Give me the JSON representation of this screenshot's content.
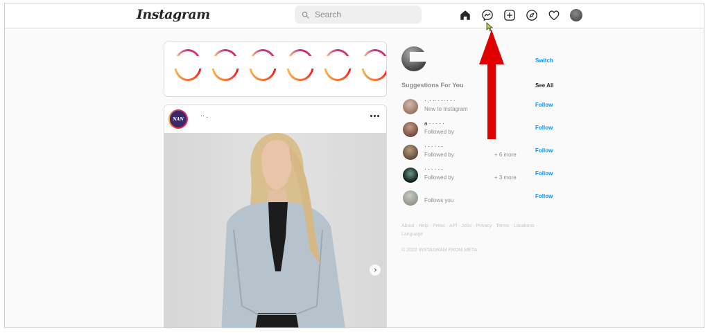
{
  "header": {
    "logo": "Instagram",
    "search_placeholder": "Search"
  },
  "nav_icons": [
    "home-icon",
    "messenger-icon",
    "new-post-icon",
    "explore-icon",
    "activity-heart-icon",
    "profile-avatar"
  ],
  "post": {
    "avatar_text": "NAN",
    "username": "·· .",
    "menu_icon": "more-horizontal-icon"
  },
  "sidebar": {
    "switch_label": "Switch",
    "suggestions_title": "Suggestions For You",
    "see_all": "See All",
    "suggestions": [
      {
        "name": "· .· ·· · ·· · · ·",
        "subtitle": "New to Instagram",
        "more": "",
        "follow": "Follow"
      },
      {
        "name": "a · · · · ·",
        "subtitle": "Followed by",
        "more": "",
        "follow": "Follow"
      },
      {
        "name": "· · · · · ·",
        "subtitle": "Followed by",
        "more": "+ 6 more",
        "follow": "Follow"
      },
      {
        "name": "· · · · · ·",
        "subtitle": "Followed by",
        "more": "+ 3 more",
        "follow": "Follow"
      },
      {
        "name": "",
        "subtitle": "Follows you",
        "more": "",
        "follow": "Follow"
      }
    ],
    "footer_links": "About · Help · Press · API · Jobs · Privacy · Terms · Locations · Language",
    "copyright": "© 2022 INSTAGRAM FROM META"
  },
  "colors": {
    "accent": "#0095f6",
    "annotation_arrow": "#e00000"
  }
}
